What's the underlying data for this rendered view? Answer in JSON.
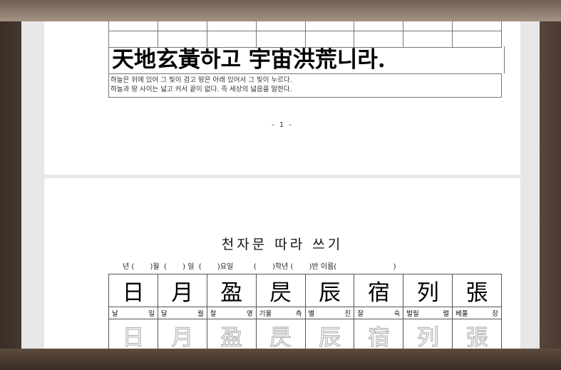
{
  "page1": {
    "han_line": "天地玄黃하고 宇宙洪荒니라.",
    "meaning_line1": "하늘은 위에 있어 그 빛이 검고 땅은 아래 있어서 그 빛이 누르다.",
    "meaning_line2": "하늘과 땅 사이는 넓고 커서 끝이 없다. 즉 세상의 넓음을 말한다.",
    "page_number": "- 1 -"
  },
  "page2": {
    "title": "천자문 따라 쓰기",
    "date_line": "년 (       )월  (       ) 일  (       )요일         (       )학년 (       )반 이름(                         )",
    "chars": [
      {
        "hanja": "日",
        "sound_left": "날",
        "sound_right": "일"
      },
      {
        "hanja": "月",
        "sound_left": "달",
        "sound_right": "월"
      },
      {
        "hanja": "盈",
        "sound_left": "찰",
        "sound_right": "영"
      },
      {
        "hanja": "昃",
        "sound_left": "기울",
        "sound_right": "측"
      },
      {
        "hanja": "辰",
        "sound_left": "별",
        "sound_right": "진"
      },
      {
        "hanja": "宿",
        "sound_left": "잘",
        "sound_right": "숙"
      },
      {
        "hanja": "列",
        "sound_left": "벌릴",
        "sound_right": "렬"
      },
      {
        "hanja": "張",
        "sound_left": "베풀",
        "sound_right": "장"
      }
    ]
  }
}
